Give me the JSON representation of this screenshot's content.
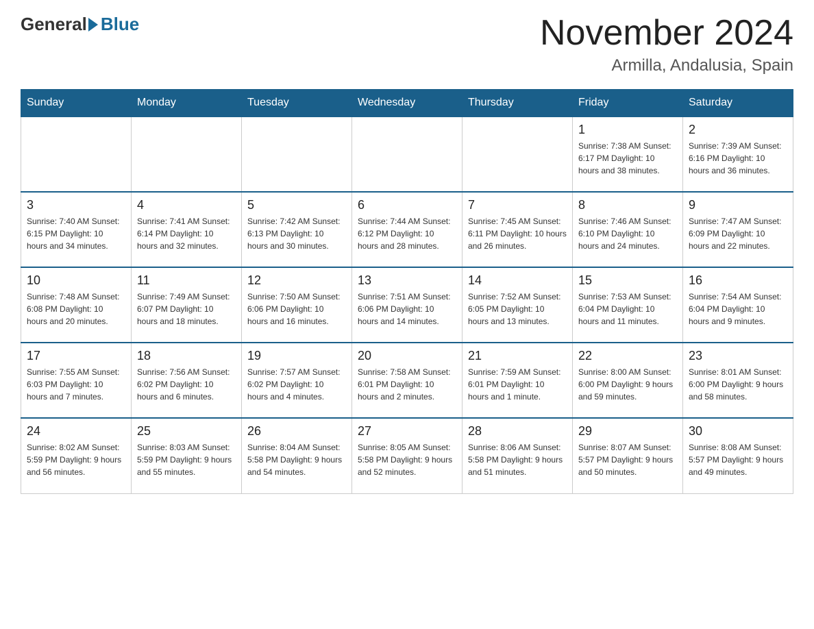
{
  "header": {
    "logo_general": "General",
    "logo_blue": "Blue",
    "month_title": "November 2024",
    "location": "Armilla, Andalusia, Spain"
  },
  "weekdays": [
    "Sunday",
    "Monday",
    "Tuesday",
    "Wednesday",
    "Thursday",
    "Friday",
    "Saturday"
  ],
  "weeks": [
    [
      {
        "day": "",
        "info": ""
      },
      {
        "day": "",
        "info": ""
      },
      {
        "day": "",
        "info": ""
      },
      {
        "day": "",
        "info": ""
      },
      {
        "day": "",
        "info": ""
      },
      {
        "day": "1",
        "info": "Sunrise: 7:38 AM\nSunset: 6:17 PM\nDaylight: 10 hours and 38 minutes."
      },
      {
        "day": "2",
        "info": "Sunrise: 7:39 AM\nSunset: 6:16 PM\nDaylight: 10 hours and 36 minutes."
      }
    ],
    [
      {
        "day": "3",
        "info": "Sunrise: 7:40 AM\nSunset: 6:15 PM\nDaylight: 10 hours and 34 minutes."
      },
      {
        "day": "4",
        "info": "Sunrise: 7:41 AM\nSunset: 6:14 PM\nDaylight: 10 hours and 32 minutes."
      },
      {
        "day": "5",
        "info": "Sunrise: 7:42 AM\nSunset: 6:13 PM\nDaylight: 10 hours and 30 minutes."
      },
      {
        "day": "6",
        "info": "Sunrise: 7:44 AM\nSunset: 6:12 PM\nDaylight: 10 hours and 28 minutes."
      },
      {
        "day": "7",
        "info": "Sunrise: 7:45 AM\nSunset: 6:11 PM\nDaylight: 10 hours and 26 minutes."
      },
      {
        "day": "8",
        "info": "Sunrise: 7:46 AM\nSunset: 6:10 PM\nDaylight: 10 hours and 24 minutes."
      },
      {
        "day": "9",
        "info": "Sunrise: 7:47 AM\nSunset: 6:09 PM\nDaylight: 10 hours and 22 minutes."
      }
    ],
    [
      {
        "day": "10",
        "info": "Sunrise: 7:48 AM\nSunset: 6:08 PM\nDaylight: 10 hours and 20 minutes."
      },
      {
        "day": "11",
        "info": "Sunrise: 7:49 AM\nSunset: 6:07 PM\nDaylight: 10 hours and 18 minutes."
      },
      {
        "day": "12",
        "info": "Sunrise: 7:50 AM\nSunset: 6:06 PM\nDaylight: 10 hours and 16 minutes."
      },
      {
        "day": "13",
        "info": "Sunrise: 7:51 AM\nSunset: 6:06 PM\nDaylight: 10 hours and 14 minutes."
      },
      {
        "day": "14",
        "info": "Sunrise: 7:52 AM\nSunset: 6:05 PM\nDaylight: 10 hours and 13 minutes."
      },
      {
        "day": "15",
        "info": "Sunrise: 7:53 AM\nSunset: 6:04 PM\nDaylight: 10 hours and 11 minutes."
      },
      {
        "day": "16",
        "info": "Sunrise: 7:54 AM\nSunset: 6:04 PM\nDaylight: 10 hours and 9 minutes."
      }
    ],
    [
      {
        "day": "17",
        "info": "Sunrise: 7:55 AM\nSunset: 6:03 PM\nDaylight: 10 hours and 7 minutes."
      },
      {
        "day": "18",
        "info": "Sunrise: 7:56 AM\nSunset: 6:02 PM\nDaylight: 10 hours and 6 minutes."
      },
      {
        "day": "19",
        "info": "Sunrise: 7:57 AM\nSunset: 6:02 PM\nDaylight: 10 hours and 4 minutes."
      },
      {
        "day": "20",
        "info": "Sunrise: 7:58 AM\nSunset: 6:01 PM\nDaylight: 10 hours and 2 minutes."
      },
      {
        "day": "21",
        "info": "Sunrise: 7:59 AM\nSunset: 6:01 PM\nDaylight: 10 hours and 1 minute."
      },
      {
        "day": "22",
        "info": "Sunrise: 8:00 AM\nSunset: 6:00 PM\nDaylight: 9 hours and 59 minutes."
      },
      {
        "day": "23",
        "info": "Sunrise: 8:01 AM\nSunset: 6:00 PM\nDaylight: 9 hours and 58 minutes."
      }
    ],
    [
      {
        "day": "24",
        "info": "Sunrise: 8:02 AM\nSunset: 5:59 PM\nDaylight: 9 hours and 56 minutes."
      },
      {
        "day": "25",
        "info": "Sunrise: 8:03 AM\nSunset: 5:59 PM\nDaylight: 9 hours and 55 minutes."
      },
      {
        "day": "26",
        "info": "Sunrise: 8:04 AM\nSunset: 5:58 PM\nDaylight: 9 hours and 54 minutes."
      },
      {
        "day": "27",
        "info": "Sunrise: 8:05 AM\nSunset: 5:58 PM\nDaylight: 9 hours and 52 minutes."
      },
      {
        "day": "28",
        "info": "Sunrise: 8:06 AM\nSunset: 5:58 PM\nDaylight: 9 hours and 51 minutes."
      },
      {
        "day": "29",
        "info": "Sunrise: 8:07 AM\nSunset: 5:57 PM\nDaylight: 9 hours and 50 minutes."
      },
      {
        "day": "30",
        "info": "Sunrise: 8:08 AM\nSunset: 5:57 PM\nDaylight: 9 hours and 49 minutes."
      }
    ]
  ]
}
